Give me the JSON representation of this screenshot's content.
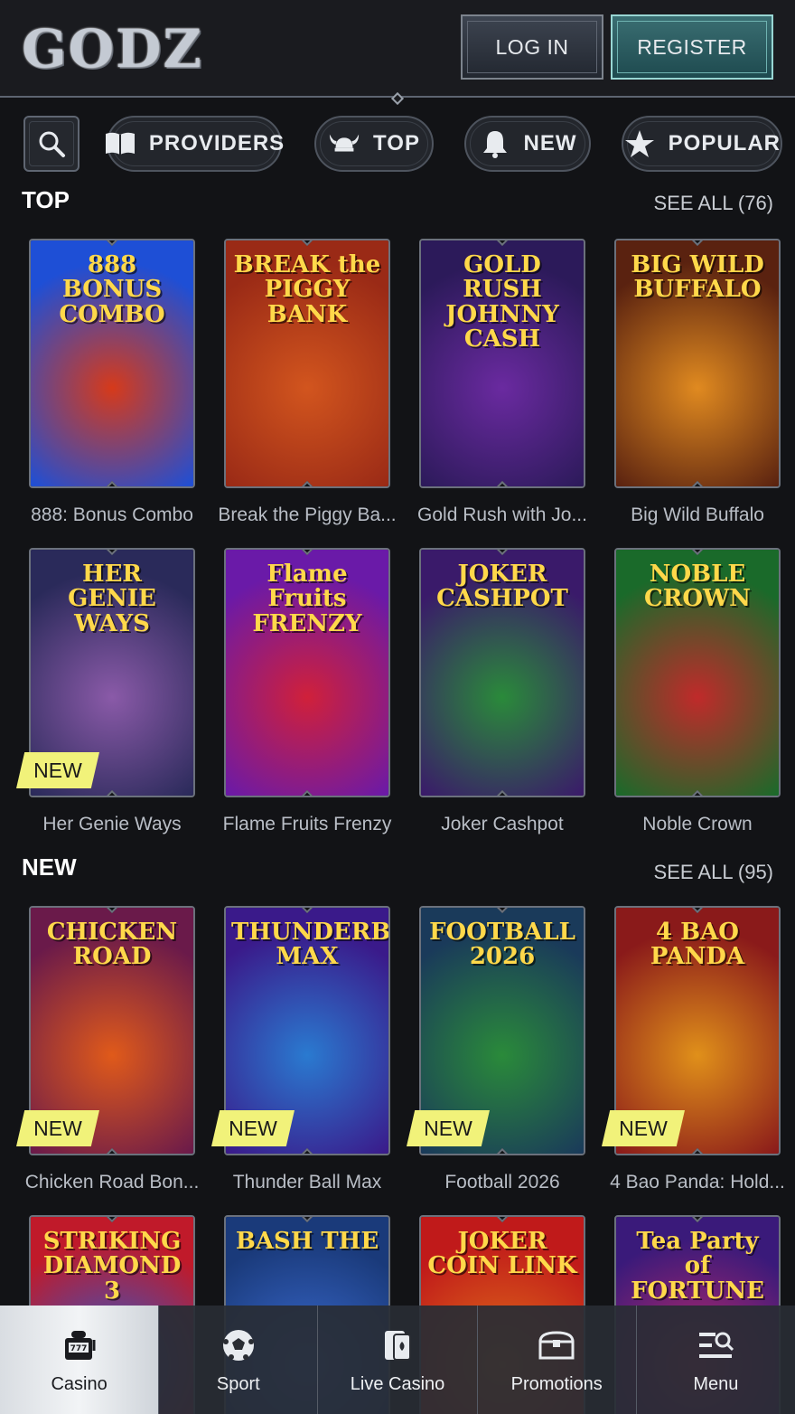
{
  "header": {
    "logo_text": "GODZ",
    "login_label": "LOG IN",
    "register_label": "REGISTER"
  },
  "filters": {
    "search_icon": "search-icon",
    "items": [
      {
        "label": "PROVIDERS",
        "icon": "book-icon"
      },
      {
        "label": "TOP",
        "icon": "viking-helmet-icon"
      },
      {
        "label": "NEW",
        "icon": "bell-icon"
      },
      {
        "label": "POPULAR",
        "icon": "star-icon"
      }
    ]
  },
  "sections": {
    "top": {
      "title": "TOP",
      "see_all": "SEE ALL (76)",
      "games": [
        {
          "title": "888: Bonus Combo",
          "art": "888\nBONUS COMBO",
          "new": false,
          "colors": [
            "#1e4fd6",
            "#d63a1a"
          ]
        },
        {
          "title": "Break the Piggy Ba...",
          "art": "BREAK the\nPIGGY BANK",
          "new": false,
          "colors": [
            "#9a2a16",
            "#d2551e"
          ]
        },
        {
          "title": "Gold Rush with Jo...",
          "art": "GOLD RUSH\nJOHNNY CASH",
          "new": false,
          "colors": [
            "#2c1a5a",
            "#6a2aa0"
          ]
        },
        {
          "title": "Big Wild Buffalo",
          "art": "BIG WILD\nBUFFALO",
          "new": false,
          "colors": [
            "#5a2210",
            "#e08a20"
          ]
        },
        {
          "title": "Her Genie Ways",
          "art": "HER GENIE WAYS",
          "new": true,
          "badge": "NEW",
          "colors": [
            "#2a2a5a",
            "#8a5aa8"
          ]
        },
        {
          "title": "Flame Fruits Frenzy",
          "art": "Flame Fruits\nFRENZY",
          "new": false,
          "colors": [
            "#6a1aa8",
            "#d0203a"
          ]
        },
        {
          "title": "Joker Cashpot",
          "art": "JOKER\nCASHPOT",
          "new": false,
          "colors": [
            "#3a1a6a",
            "#2a8a3a"
          ]
        },
        {
          "title": "Noble Crown",
          "art": "NOBLE\nCROWN",
          "new": false,
          "colors": [
            "#1a6a2a",
            "#c02a2a"
          ]
        }
      ]
    },
    "new": {
      "title": "NEW",
      "see_all": "SEE ALL (95)",
      "games": [
        {
          "title": "Chicken Road Bon...",
          "art": "CHICKEN\nROAD",
          "new": true,
          "badge": "NEW",
          "colors": [
            "#6a1a4a",
            "#e05a1a"
          ]
        },
        {
          "title": "Thunder Ball Max",
          "art": "THUNDERBALL\nMAX",
          "new": true,
          "badge": "NEW",
          "colors": [
            "#3a1a8a",
            "#2a7ad0"
          ]
        },
        {
          "title": "Football 2026",
          "art": "FOOTBALL 2026",
          "new": true,
          "badge": "NEW",
          "colors": [
            "#1a3a5a",
            "#2a8a3a"
          ]
        },
        {
          "title": "4 Bao Panda: Hold...",
          "art": "4 BAO\nPANDA",
          "new": true,
          "badge": "NEW",
          "colors": [
            "#8a1a1a",
            "#e0901a"
          ]
        }
      ]
    },
    "partial": {
      "games": [
        {
          "art": "STRIKING\nDIAMOND 3",
          "colors": [
            "#c01a2a",
            "#2a5ad0"
          ]
        },
        {
          "art": "BASH THE",
          "colors": [
            "#1a3a7a",
            "#3a6ad0"
          ]
        },
        {
          "art": "JOKER\nCOIN LINK",
          "colors": [
            "#c01a1a",
            "#e0701a"
          ]
        },
        {
          "art": "Tea Party\nof FORTUNE",
          "colors": [
            "#3a1a7a",
            "#c02a6a"
          ]
        }
      ]
    }
  },
  "bottom_nav": {
    "items": [
      {
        "label": "Casino",
        "icon": "slot-machine-icon",
        "active": true
      },
      {
        "label": "Sport",
        "icon": "soccer-ball-icon",
        "active": false
      },
      {
        "label": "Live Casino",
        "icon": "playing-card-icon",
        "active": false
      },
      {
        "label": "Promotions",
        "icon": "treasure-chest-icon",
        "active": false
      },
      {
        "label": "Menu",
        "icon": "menu-search-icon",
        "active": false
      }
    ]
  }
}
